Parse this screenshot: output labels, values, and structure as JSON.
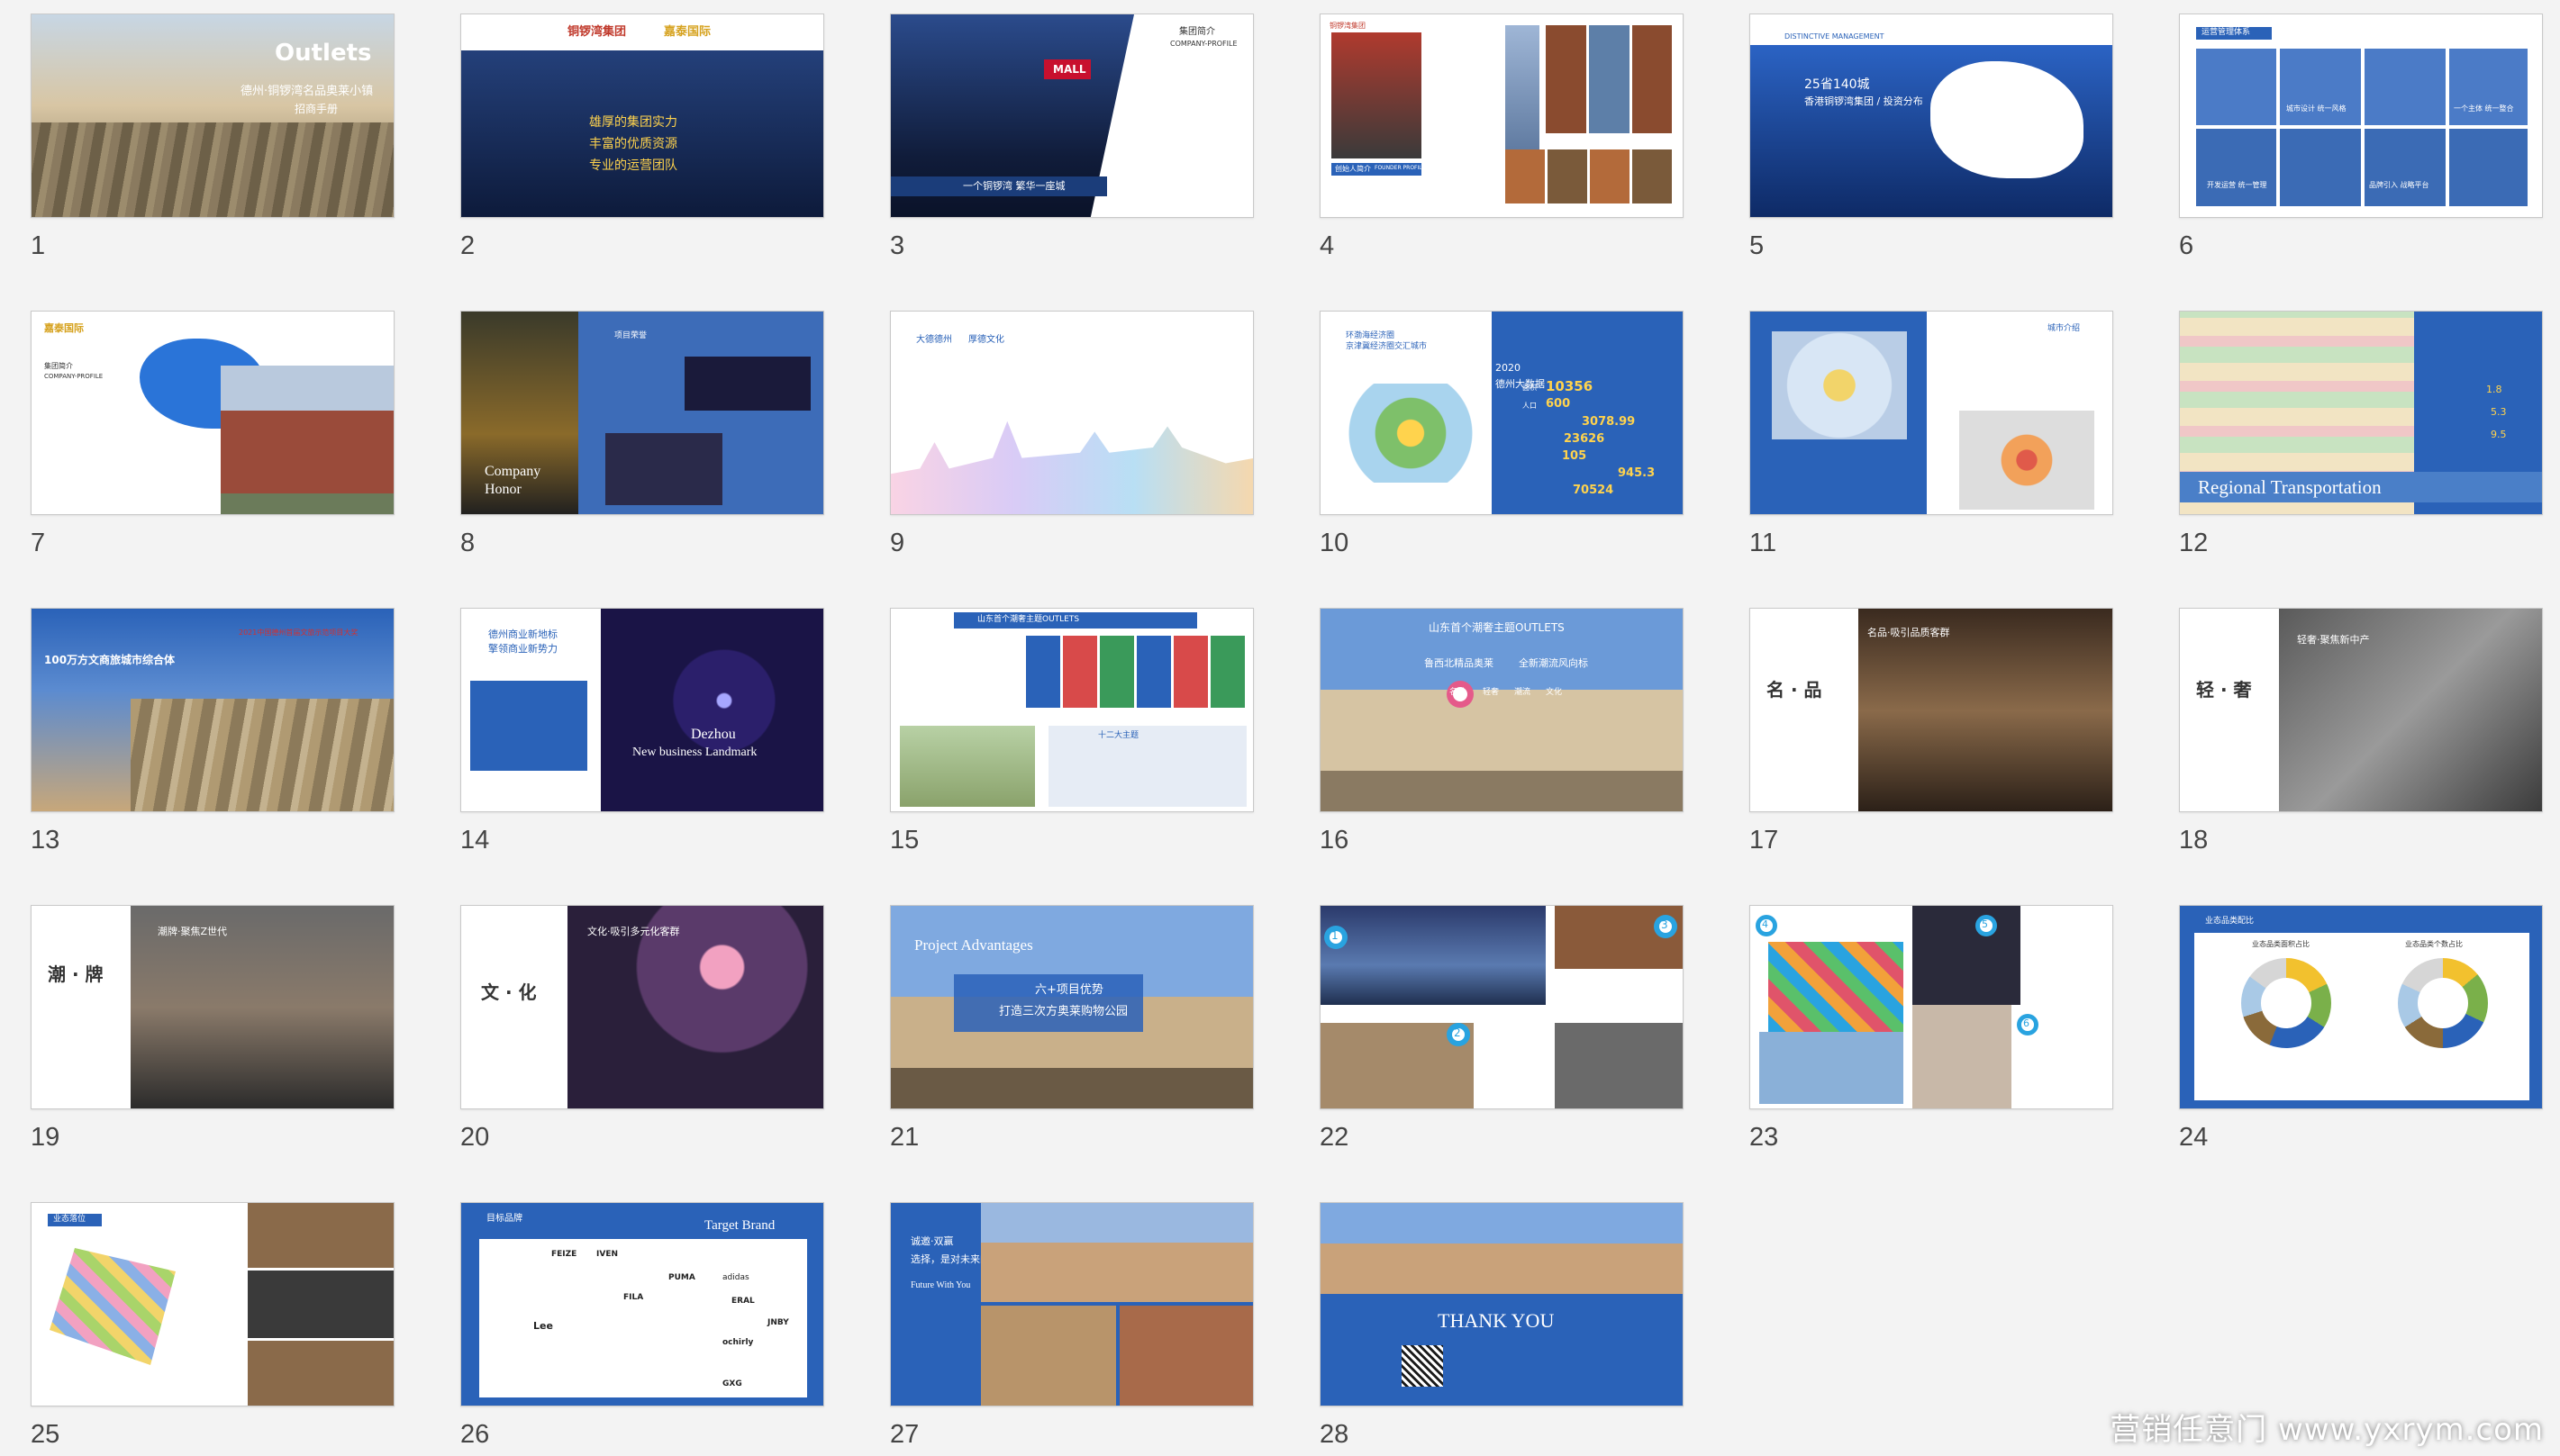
{
  "colors": {
    "background": "#f3f3f3",
    "number": "#444444",
    "primary_blue": "#2a62b8",
    "gold": "#e2b23a"
  },
  "slides": [
    {
      "number": "1",
      "t1": "Outlets",
      "t2": "德州·铜锣湾名品奥莱小镇",
      "t3": "招商手册"
    },
    {
      "number": "2",
      "t1": "铜锣湾集团",
      "t2": "嘉泰国际",
      "t3": "雄厚的集团实力",
      "t4": "丰富的优质资源",
      "t5": "专业的运营团队"
    },
    {
      "number": "3",
      "t1": "MALL",
      "t2": "集团简介",
      "t3": "COMPANY-PROFILE",
      "t4": "一个铜锣湾 繁华一座城"
    },
    {
      "number": "4",
      "t1": "铜锣湾集团",
      "t2": "创始人简介",
      "t3": "FOUNDER PROFILE"
    },
    {
      "number": "5",
      "t1": "DISTINCTIVE MANAGEMENT",
      "t2": "25省140城",
      "t3": "香港铜锣湾集团 / 投资分布"
    },
    {
      "number": "6",
      "t1": "运营管理体系",
      "t2": "城市设计 统一风格",
      "t3": "一个主体 统一整合",
      "t4": "开发运营 统一管理",
      "t5": "品牌引入 战略平台"
    },
    {
      "number": "7",
      "t1": "嘉泰国际",
      "t2": "集团简介",
      "t3": "COMPANY-PROFILE"
    },
    {
      "number": "8",
      "t1": "Company",
      "t2": "Honor",
      "t3": "项目荣誉"
    },
    {
      "number": "9",
      "t1": "大德德州",
      "t2": "厚德文化"
    },
    {
      "number": "10",
      "t1": "环渤海经济圈",
      "t2": "京津冀经济圈交汇城市",
      "t3": "德州大数据",
      "t4": "2020",
      "t5": "面积",
      "v1": "10356",
      "t6": "人口",
      "v2": "600",
      "v3": "3078.99",
      "v4": "23626",
      "v5": "105",
      "v6": "945.3",
      "v7": "70524"
    },
    {
      "number": "11",
      "t1": "城市介绍"
    },
    {
      "number": "12",
      "t1": "Regional Transportation",
      "v1": "1.8",
      "v2": "5.3",
      "v3": "9.5"
    },
    {
      "number": "13",
      "t1": "100万方文商旅城市综合体",
      "t2": "2021中国德州首届文旅示范项目大奖"
    },
    {
      "number": "14",
      "t1": "德州商业新地标",
      "t2": "擎领商业新势力",
      "t3": "Dezhou",
      "t4": "New business Landmark"
    },
    {
      "number": "15",
      "t1": "山东首个潮奢主题OUTLETS",
      "t2": "十二大主题"
    },
    {
      "number": "16",
      "t1": "山东首个潮奢主题OUTLETS",
      "t2": "鲁西北精品奥莱",
      "t3": "全新潮流风向标",
      "t4": "名品",
      "t5": "轻奢",
      "t6": "潮流",
      "t7": "文化"
    },
    {
      "number": "17",
      "t1": "名 · 品",
      "t2": "名品·吸引品质客群"
    },
    {
      "number": "18",
      "t1": "轻 · 奢",
      "t2": "轻奢·聚焦新中产"
    },
    {
      "number": "19",
      "t1": "潮 · 牌",
      "t2": "潮牌·聚焦Z世代"
    },
    {
      "number": "20",
      "t1": "文 · 化",
      "t2": "文化·吸引多元化客群"
    },
    {
      "number": "21",
      "t1": "Project Advantages",
      "t2": "六+项目优势",
      "t3": "打造三次方奥莱购物公园"
    },
    {
      "number": "22",
      "b1": "1",
      "b2": "2",
      "b3": "3"
    },
    {
      "number": "23",
      "b1": "4",
      "b2": "5",
      "b3": "6"
    },
    {
      "number": "24",
      "t1": "业态品类配比",
      "t2": "业态品类面积占比",
      "t3": "业态品类个数占比"
    },
    {
      "number": "25",
      "t1": "业态落位"
    },
    {
      "number": "26",
      "t1": "目标品牌",
      "t2": "Target Brand",
      "brands": [
        "FEIZE",
        "IVEN",
        "PUMA",
        "adidas",
        "Lee",
        "ochirly",
        "FILA",
        "ERAL",
        "JNBY",
        "GXG"
      ]
    },
    {
      "number": "27",
      "t1": "诚邀·双赢",
      "t2": "选择，是对未来的预见",
      "t3": "Future With You"
    },
    {
      "number": "28",
      "t1": "THANK YOU"
    }
  ],
  "watermark": "营销任意门 www.yxrym.com"
}
